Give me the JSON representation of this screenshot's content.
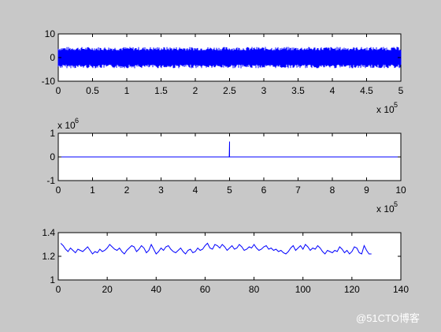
{
  "figure": {
    "background": "#c8c8c8",
    "axes_background": "#ffffff",
    "line_color": "#0000ff",
    "watermark": "@51CTO博客"
  },
  "chart_data": [
    {
      "type": "line",
      "title": "",
      "xlabel": "",
      "ylabel": "",
      "xlim": [
        0,
        5
      ],
      "ylim": [
        -10,
        10
      ],
      "x_ticks": [
        "0",
        "0.5",
        "1",
        "1.5",
        "2",
        "2.5",
        "3",
        "3.5",
        "4",
        "4.5",
        "5"
      ],
      "y_ticks": [
        "10",
        "0",
        "-10"
      ],
      "x_exponent": {
        "base": "x 10",
        "power": "5"
      },
      "series": [
        {
          "description": "dense noise signal",
          "band": [
            -3,
            3
          ],
          "peak_band": [
            -4.5,
            4.5
          ]
        }
      ],
      "grid": false
    },
    {
      "type": "line",
      "title": "",
      "xlabel": "",
      "ylabel": "",
      "xlim": [
        0,
        10
      ],
      "ylim": [
        -1,
        1
      ],
      "x_ticks": [
        "0",
        "1",
        "2",
        "3",
        "4",
        "5",
        "6",
        "7",
        "8",
        "9",
        "10"
      ],
      "y_ticks": [
        "1",
        "0",
        "-1"
      ],
      "x_exponent": {
        "base": "x 10",
        "power": "5"
      },
      "y_exponent": {
        "base": "x 10",
        "power": "6"
      },
      "series": [
        {
          "x": [
            0,
            4.99,
            5.0,
            5.0,
            5.005,
            10
          ],
          "y": [
            0,
            0,
            0.65,
            0.0,
            0,
            0
          ]
        }
      ],
      "grid": false
    },
    {
      "type": "line",
      "title": "",
      "xlabel": "",
      "ylabel": "",
      "xlim": [
        0,
        140
      ],
      "ylim": [
        1,
        1.4
      ],
      "x_ticks": [
        "0",
        "20",
        "40",
        "60",
        "80",
        "100",
        "120",
        "140"
      ],
      "y_ticks": [
        "1.4",
        "1.2",
        "1"
      ],
      "series": [
        {
          "x": [
            1,
            2,
            3,
            4,
            5,
            6,
            7,
            8,
            9,
            10,
            11,
            12,
            13,
            14,
            15,
            16,
            17,
            18,
            19,
            20,
            21,
            22,
            23,
            24,
            25,
            26,
            27,
            28,
            29,
            30,
            31,
            32,
            33,
            34,
            35,
            36,
            37,
            38,
            39,
            40,
            41,
            42,
            43,
            44,
            45,
            46,
            47,
            48,
            49,
            50,
            51,
            52,
            53,
            54,
            55,
            56,
            57,
            58,
            59,
            60,
            61,
            62,
            63,
            64,
            65,
            66,
            67,
            68,
            69,
            70,
            71,
            72,
            73,
            74,
            75,
            76,
            77,
            78,
            79,
            80,
            81,
            82,
            83,
            84,
            85,
            86,
            87,
            88,
            89,
            90,
            91,
            92,
            93,
            94,
            95,
            96,
            97,
            98,
            99,
            100,
            101,
            102,
            103,
            104,
            105,
            106,
            107,
            108,
            109,
            110,
            111,
            112,
            113,
            114,
            115,
            116,
            117,
            118,
            119,
            120,
            121,
            122,
            123,
            124,
            125,
            126,
            127,
            128
          ],
          "y": [
            1.31,
            1.29,
            1.26,
            1.24,
            1.27,
            1.25,
            1.23,
            1.26,
            1.25,
            1.24,
            1.26,
            1.28,
            1.25,
            1.22,
            1.24,
            1.23,
            1.26,
            1.24,
            1.25,
            1.27,
            1.3,
            1.28,
            1.26,
            1.25,
            1.27,
            1.24,
            1.22,
            1.25,
            1.27,
            1.29,
            1.28,
            1.24,
            1.26,
            1.29,
            1.27,
            1.23,
            1.25,
            1.3,
            1.26,
            1.22,
            1.24,
            1.27,
            1.25,
            1.28,
            1.29,
            1.26,
            1.24,
            1.23,
            1.25,
            1.27,
            1.24,
            1.22,
            1.25,
            1.26,
            1.23,
            1.24,
            1.27,
            1.25,
            1.26,
            1.29,
            1.31,
            1.27,
            1.26,
            1.3,
            1.29,
            1.27,
            1.3,
            1.28,
            1.25,
            1.27,
            1.29,
            1.26,
            1.27,
            1.3,
            1.28,
            1.25,
            1.26,
            1.28,
            1.27,
            1.3,
            1.27,
            1.25,
            1.26,
            1.28,
            1.29,
            1.26,
            1.27,
            1.25,
            1.26,
            1.24,
            1.25,
            1.23,
            1.22,
            1.24,
            1.27,
            1.29,
            1.25,
            1.27,
            1.29,
            1.26,
            1.3,
            1.28,
            1.25,
            1.27,
            1.26,
            1.29,
            1.27,
            1.24,
            1.22,
            1.25,
            1.24,
            1.23,
            1.25,
            1.24,
            1.28,
            1.26,
            1.23,
            1.25,
            1.22,
            1.24,
            1.28,
            1.27,
            1.23,
            1.22,
            1.29,
            1.25,
            1.22,
            1.22
          ]
        }
      ],
      "grid": false
    }
  ]
}
